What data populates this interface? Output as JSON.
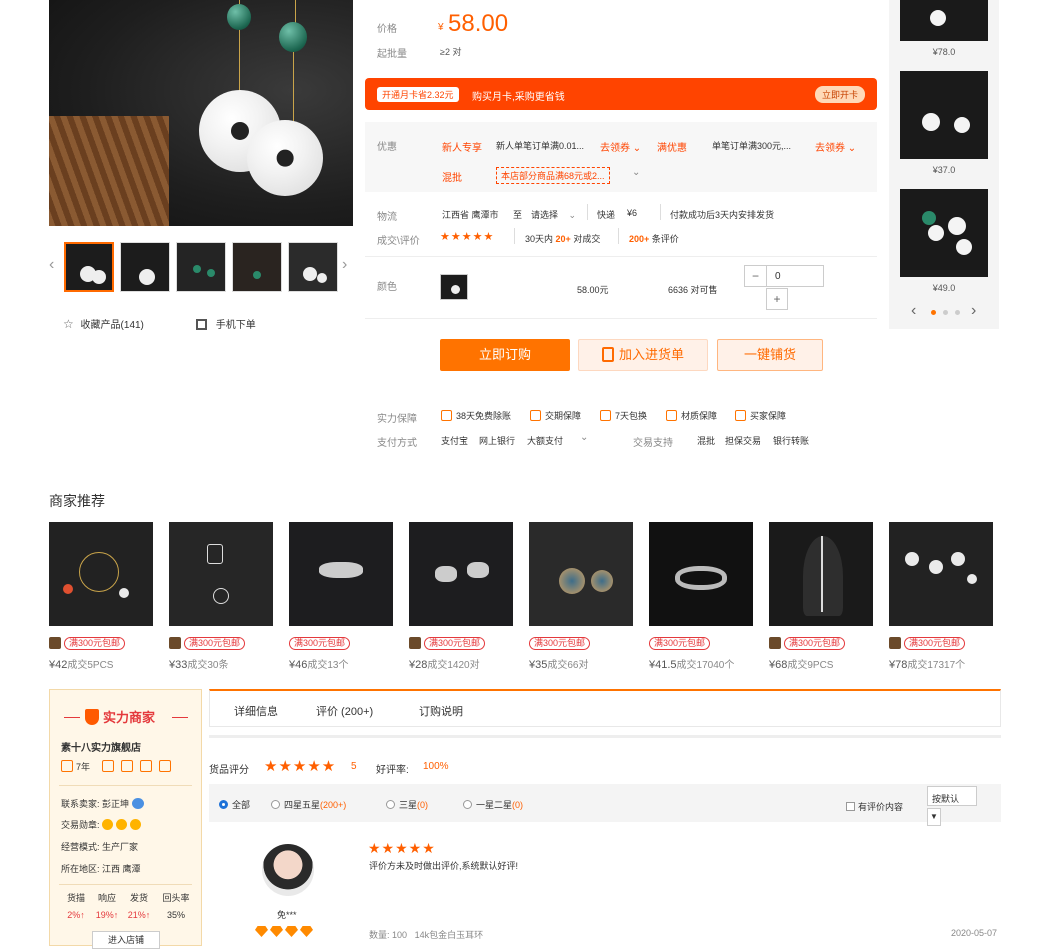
{
  "gallery": {
    "favorite_label": "收藏产品(141)",
    "mobile_order_label": "手机下单"
  },
  "price": {
    "price_label": "价格",
    "currency": "¥",
    "value": "58.00",
    "moq_label": "起批量",
    "moq_value": "≥2 对"
  },
  "promo": {
    "tag": "开通月卡省2.32元",
    "text": "购买月卡,采购更省钱",
    "button": "立即开卡"
  },
  "coupons": {
    "label": "优惠",
    "row1": [
      {
        "tag": "新人专享",
        "text": "新人单笔订单满0.01...",
        "link": "去领券"
      },
      {
        "tag": "满优惠",
        "text": "单笔订单满300元,...",
        "link": "去领券"
      }
    ],
    "row2_tag": "混批",
    "row2_text": "本店部分商品满68元或2..."
  },
  "logistics": {
    "label": "物流",
    "from": "江西省 鹰潭市",
    "to_prefix": "至",
    "to_select": "请选择",
    "method": "快递",
    "fee": "¥6",
    "note": "付款成功后3天内安排发货"
  },
  "reviews_summary": {
    "label": "成交\\评价",
    "stars": "★★★★★",
    "deal_prefix": "30天内",
    "deal_count": "20+",
    "deal_suffix": "对成交",
    "review_count": "200+",
    "review_suffix": "条评价"
  },
  "color": {
    "label": "颜色",
    "price": "58.00元",
    "stock": "6636 对可售",
    "qty": "0",
    "minus": "−",
    "plus": "+"
  },
  "actions": {
    "buy": "立即订购",
    "cart": "加入进货单",
    "distribute": "一键铺货"
  },
  "guarantee": {
    "label": "实力保障",
    "items": [
      "38天免费除账",
      "交期保障",
      "7天包换",
      "材质保障",
      "买家保障"
    ],
    "pay_label": "支付方式",
    "pay_items": [
      "支付宝",
      "网上银行",
      "大额支付"
    ],
    "trade_label": "交易支持",
    "trade_items": [
      "混批",
      "担保交易",
      "银行转账"
    ]
  },
  "right_recs": [
    {
      "price": "¥78.0"
    },
    {
      "price": "¥37.0"
    },
    {
      "price": "¥49.0"
    }
  ],
  "merchant_recs": {
    "title": "商家推荐",
    "tag": "满300元包邮",
    "items": [
      {
        "price": "¥42",
        "deal": "成交5PCS"
      },
      {
        "price": "¥33",
        "deal": "成交30条"
      },
      {
        "price": "¥46",
        "deal": "成交13个"
      },
      {
        "price": "¥28",
        "deal": "成交1420对"
      },
      {
        "price": "¥35",
        "deal": "成交66对"
      },
      {
        "price": "¥41.5",
        "deal": "成交17040个"
      },
      {
        "price": "¥68",
        "deal": "成交9PCS"
      },
      {
        "price": "¥78",
        "deal": "成交17317个"
      }
    ]
  },
  "shop": {
    "logo": "实力商家",
    "name": "素十八实力旗舰店",
    "years": "7年",
    "contact_label": "联系卖家:",
    "contact": "彭正坤",
    "level_label": "交易勋章:",
    "mode_label": "经营模式:",
    "mode": "生产厂家",
    "region_label": "所在地区:",
    "region": "江西 鹰潭",
    "stats": [
      {
        "label": "货描",
        "value": "2%↑"
      },
      {
        "label": "响应",
        "value": "19%↑"
      },
      {
        "label": "发货",
        "value": "21%↑"
      },
      {
        "label": "回头率",
        "value": "35%"
      }
    ],
    "enter": "进入店铺"
  },
  "tabs": [
    "详细信息",
    "评价 (200+)",
    "订购说明"
  ],
  "rating": {
    "label": "货品评分",
    "stars": "★★★★★",
    "score": "5",
    "good_label": "好评率:",
    "good_value": "100%"
  },
  "filter": {
    "all": "全部",
    "four_five": "四星五星",
    "four_five_count": "(200+)",
    "three": "三星",
    "three_count": "(0)",
    "one_two": "一星二星",
    "one_two_count": "(0)",
    "has_content": "有评价内容",
    "sort": "按默认",
    "sort_arrow": "▼"
  },
  "review": {
    "user": "免***",
    "stars": "★★★★★",
    "text": "评价方未及时做出评价,系统默认好评!",
    "qty_label": "数量:",
    "qty": "100",
    "product": "14k包金白玉耳环",
    "date": "2020-05-07"
  }
}
